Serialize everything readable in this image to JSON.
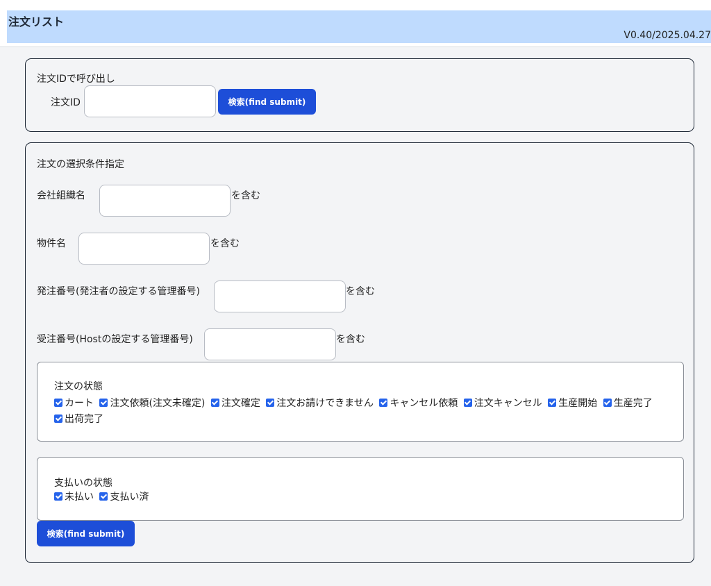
{
  "header": {
    "title": "注文リスト",
    "version": "V0.40/2025.04.27"
  },
  "order_id_section": {
    "heading": "注文IDで呼び出し",
    "field_label": "注文ID",
    "field_value": "",
    "submit_label": "検索(find submit)"
  },
  "criteria_section": {
    "heading": "注文の選択条件指定",
    "contains_suffix": "を含む",
    "fields": [
      {
        "label": "会社組織名",
        "value": ""
      },
      {
        "label": "物件名",
        "value": ""
      },
      {
        "label": "発注番号(発注者の設定する管理番号)",
        "value": ""
      },
      {
        "label": "受注番号(Hostの設定する管理番号)",
        "value": ""
      }
    ],
    "order_status": {
      "heading": "注文の状態",
      "options": [
        {
          "label": "カート",
          "checked": true
        },
        {
          "label": "注文依頼(注文未確定)",
          "checked": true
        },
        {
          "label": "注文確定",
          "checked": true
        },
        {
          "label": "注文お請けできません",
          "checked": true
        },
        {
          "label": "キャンセル依頼",
          "checked": true
        },
        {
          "label": "注文キャンセル",
          "checked": true
        },
        {
          "label": "生産開始",
          "checked": true
        },
        {
          "label": "生産完了",
          "checked": true
        },
        {
          "label": "出荷完了",
          "checked": true
        }
      ]
    },
    "payment_status": {
      "heading": "支払いの状態",
      "options": [
        {
          "label": "未払い",
          "checked": true
        },
        {
          "label": "支払い済",
          "checked": true
        }
      ]
    },
    "submit_label": "検索(find submit)"
  },
  "colors": {
    "header_bg": "#bfdbfe",
    "button_bg": "#1d4ed8",
    "checkbox": "#2563eb"
  }
}
